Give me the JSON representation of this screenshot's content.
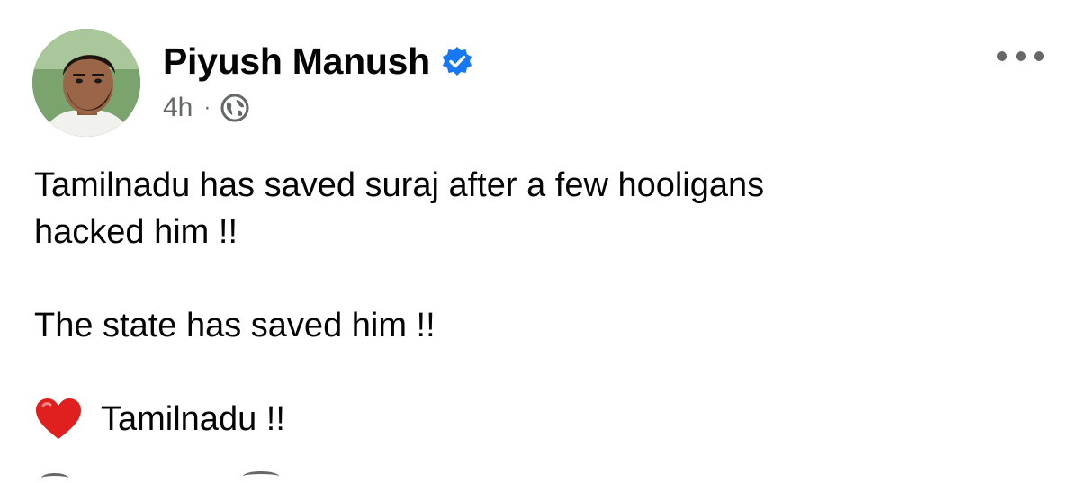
{
  "post": {
    "author": {
      "name": "Piyush Manush",
      "verified": true,
      "avatar_icon": "profile-photo"
    },
    "meta": {
      "time": "4h",
      "separator": "·",
      "audience_icon": "globe-icon"
    },
    "more_icon": "more-options-icon",
    "text": {
      "line1": "Tamilnadu has saved suraj after a few hooligans",
      "line2": "hacked him !!",
      "line3": "The state has saved him !!",
      "line4_emoji": "red-heart",
      "line4": "Tamilnadu !!"
    },
    "colors": {
      "text": "#050505",
      "secondary": "#65676b",
      "verified_blue": "#1877f2",
      "heart_red": "#e0201f"
    }
  }
}
